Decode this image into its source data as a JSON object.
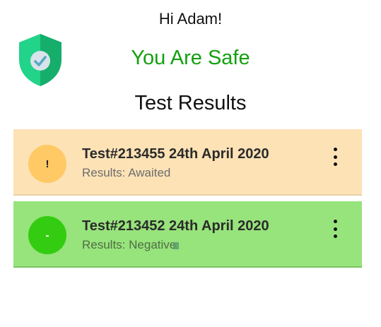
{
  "header": {
    "greeting": "Hi Adam!",
    "status": "You Are Safe",
    "shield_icon": "shield-check-icon",
    "colors": {
      "safe_text": "#13a10e",
      "shield_dark": "#0f9a5a",
      "shield_light": "#22d38a"
    }
  },
  "results": {
    "title": "Test Results",
    "items": [
      {
        "symbol": "!",
        "title": "Test#213455 24th April 2020",
        "status": "Results: Awaited",
        "color": "#fde2b6",
        "menu_icon": "more-vertical-icon"
      },
      {
        "symbol": "-",
        "title": "Test#213452 24th April 2020",
        "status": "Results: Negative",
        "color": "#97e37c",
        "menu_icon": "more-vertical-icon"
      }
    ]
  }
}
